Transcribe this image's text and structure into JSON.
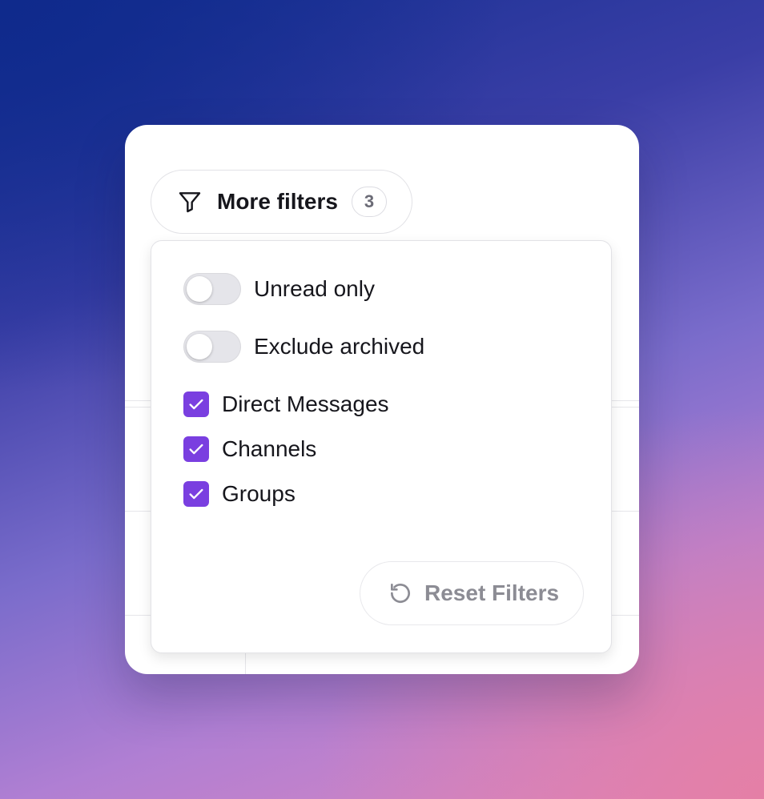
{
  "filter_button": {
    "icon": "filter-icon",
    "label": "More filters",
    "count": "3"
  },
  "toggles": [
    {
      "label": "Unread only",
      "on": false
    },
    {
      "label": "Exclude archived",
      "on": false
    }
  ],
  "checkboxes": [
    {
      "label": "Direct Messages",
      "checked": true
    },
    {
      "label": "Channels",
      "checked": true
    },
    {
      "label": "Groups",
      "checked": true
    }
  ],
  "reset_button": {
    "icon": "reset-icon",
    "label": "Reset Filters"
  },
  "colors": {
    "accent": "#7a3fe0",
    "toggle_off": "#e5e5ea",
    "text": "#16161c",
    "muted": "#8c8c94"
  }
}
